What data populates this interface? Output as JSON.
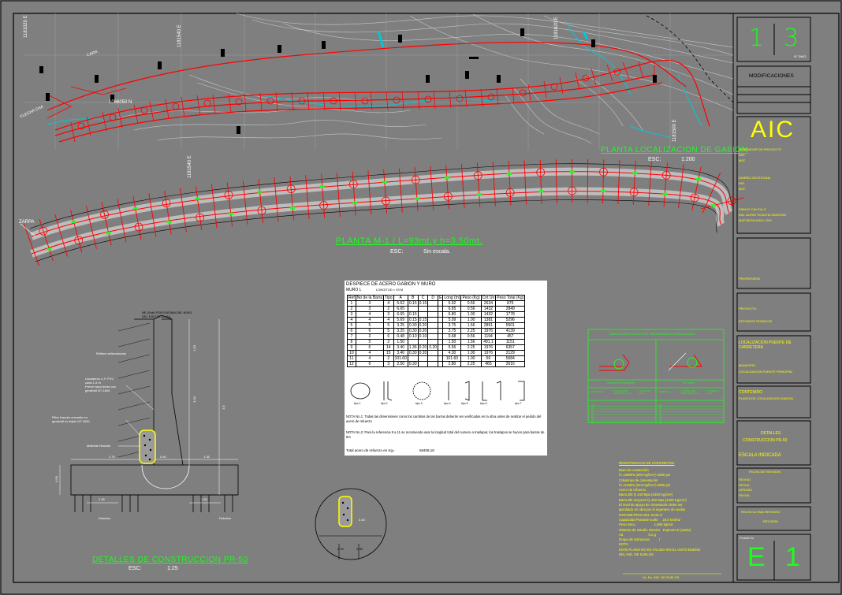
{
  "colors": {
    "background": "#7f7f7f",
    "road": "#ff0000",
    "water": "#00c8d8",
    "contour": "#c8c8c8",
    "label_green": "#19ff19",
    "label_yellow": "#ffff00",
    "frame": "#000000"
  },
  "map": {
    "coords": [
      "1181020 E",
      "1181540 E",
      "1181620 E",
      "1181500 E",
      "1066050 N"
    ],
    "arrow_label": "FLECHA CHA",
    "road_label": "CARR.",
    "title": "PLANTA LOCALIZACION DE GABION",
    "scale_prefix": "ESC:",
    "scale": "1:200"
  },
  "plan": {
    "zarpa": "ZARPA",
    "title": "PLANTA  M-1 /  L=93mt.y  h=3.50mt.",
    "scale_prefix": "ESC:",
    "scale": "Sin escala."
  },
  "section": {
    "top_note": [
      "NE (Sub) POR ENCIMA DEL NIVEL",
      "DEL EJE DE LA VIA"
    ],
    "relleno": "Relleno seleccionado",
    "lloradero": [
      "Lloraderos o 3\" PVC",
      "cada 1.5 m",
      "Prever tapa tecas con",
      "geotextil  NT-1600"
    ],
    "filtro": [
      "Filtro francés envuelto en",
      "geotextil no tejido  NT-1600"
    ],
    "material": "Material triturado",
    "dims": [
      "1.00",
      "4.00",
      "3.5",
      "1.70",
      "0.40",
      "1.35",
      "0.50",
      "1.25",
      "1.50"
    ],
    "dowel_left": "Dobelon",
    "dowel_right": "Dobelon",
    "detail_dims": [
      "0.40",
      "0.30",
      "0.35"
    ],
    "title": "DETALLES  DE  CONSTRUCCION  PR-50",
    "scale_prefix": "ESC:",
    "scale": "1:25"
  },
  "rebar": {
    "title": "DESPIECE DE ACERO GABION Y MURO",
    "subtitle_a": "MURO  L",
    "subtitle_b": "LONGITUD = 93 M",
    "headers": [
      "Ref",
      "No de la Barra",
      "Tipo",
      "A",
      "B",
      "C",
      "D",
      "E",
      "Long (m)",
      "Peso (Kg)",
      "Cnt Un",
      "Peso Total (Kg)"
    ],
    "rows": [
      [
        "1",
        "3",
        "4",
        "5.62",
        "0.15",
        "0.15",
        "",
        "",
        "5.92",
        "0.56",
        "2634",
        "875"
      ],
      [
        "2",
        "3",
        "2",
        "6.65",
        "",
        "",
        "",
        "",
        "6.65",
        "0.56",
        "1432",
        "2849"
      ],
      [
        "3",
        "4",
        "3",
        "6.65",
        "0.15",
        "",
        "",
        "",
        "6.80",
        "1.00",
        "1432",
        "1778"
      ],
      [
        "4",
        "4",
        "4",
        "5.69",
        "0.15",
        "0.15",
        "",
        "",
        "5.99",
        "1.00",
        "1381",
        "5296"
      ],
      [
        "5",
        "5",
        "5",
        "3.25",
        "0.30",
        "0.20",
        "",
        "",
        "3.75",
        "1.56",
        "2851",
        "5501"
      ],
      [
        "6",
        "6",
        "5",
        "3.25",
        "0.30",
        "0.20",
        "",
        "",
        "3.75",
        "2.25",
        "1976",
        "4139"
      ],
      [
        "7",
        "3",
        "6",
        "0.48",
        "0.10",
        "0.10",
        "",
        "",
        "0.68",
        "0.56",
        "1194",
        "457"
      ],
      [
        "8",
        "5",
        "2",
        "1.50",
        "",
        "",
        "",
        "",
        "1.50",
        "1.56",
        "491.1",
        "1151"
      ],
      [
        "9",
        "6",
        "14",
        "3.40",
        "1.36",
        "0.20",
        "0.20",
        "",
        "5.56",
        "2.25",
        "1976",
        "6357"
      ],
      [
        "10",
        "4",
        "15",
        "3.40",
        "0.30",
        "0.20",
        "",
        "",
        "4.30",
        "1.00",
        "1976",
        "2129"
      ],
      [
        "11",
        "4",
        "2",
        "101.60",
        "",
        "",
        "",
        "",
        "101.60",
        "1.00",
        "56",
        "5684"
      ],
      [
        "12",
        "6",
        "3",
        "2.50",
        "0.30",
        "",
        "",
        "",
        "2.80",
        "2.25",
        "465",
        "2616"
      ]
    ],
    "shape_labels": [
      "tipo 1",
      "tipo 2",
      "tipo 3",
      "tipo 4",
      "tipo 5",
      "tipo 6",
      "tipo 7"
    ],
    "note1": "NOTA No.1: Todas las dimensiones como los cambios de las barras deberán ser verificadas en la obra antes de realizar el pedido del acero de refuerzo",
    "note2": "NOTA No.2: Para la referencia 9 a 11 se recomienda usar la longitud total del numero a traslapar, los traslapos se hacen para barras de 6m",
    "total": "Total acero de refuerzo en Kg=",
    "total_value": "58408,18"
  },
  "hooks": {
    "title": "DIMENSIONES GANCHOS PARA BARRAS CORRUGADAS",
    "sub_left": "GANCHO ESTANDAR",
    "sub_right": "ESTRIBO",
    "head": [
      "BARRA No.",
      "D CUPLA DE DOBLADO (mm)",
      "L GANCHO (mm)"
    ],
    "rows": [
      "#3",
      "#4",
      "#5",
      "#6",
      "#7",
      "#8",
      "#9"
    ]
  },
  "specs": {
    "title": "RESISTENCIAS DE CONCRETOS",
    "lines": [
      "Muro de contención",
      "f'c=28MPa (280 Kgf/cm²) 4000 psi",
      "Columnas de cimentación",
      "f'c=21MPa (210 Kgf/cm²) 3000 psi",
      "Acero de refuerzo",
      "Barra Ø3 fy 240 Mpa (2400 Kg/cm²)",
      "Barra Ø4 mayores fy 420 Mpa (4200 Kg/cm²)",
      "El nivel de apoyo de cimentación debe ser",
      "aprobado en obra por el ingeniero de suelos",
      "PARAMETROS DEL SUELO",
      "Capacidad Portante suelo     20,0 ton/m2",
      "Peso Seco                    1,800 kg/m3",
      "Sistema de estudio sísmico   Espectro E (suelo)",
      "Aa                           0,2 g",
      "Grupo de Estructura          I",
      "NOTA:",
      "ESTE PLANO NO ES VALIDO SIN EL VISTO BUENO",
      "DEL ING. DE SUELOS"
    ],
    "signature": "Vo. Bo. ING. DE SUELOS"
  },
  "titleblock": {
    "top_symbol_a": "1",
    "top_symbol_b": "3",
    "top_small": "N° DWG",
    "modificaciones": "MODIFICACIONES",
    "logo": "AIC",
    "lines_a": [
      "DISEÑADOR DE PROYECTO",
      "ING.",
      "MAT."
    ],
    "lines_b": [
      "DISEÑO-GEOTECNIA",
      "ING.",
      "MAT."
    ],
    "lines_c": [
      "DIBUJO CALCULO",
      "ING. ALIRIO ROACHA SANCHEZ",
      "MAT:25202-54511 CND"
    ],
    "box_1": "PROPIETARIO",
    "box_2a": "PROYECTO",
    "box_2b": "ESTUDIOS TECNICOS",
    "box_3a": "LOCALIZACION PUENTE DE CARRETERA",
    "box_3b": "MUNICIPIO",
    "box_3c": "LOCALIZACION PUENTE PRINCIPAL",
    "box_4a": "CONTENIDO",
    "box_4b": "PLANTA DE LOCALIZACION GABION",
    "box_5a": "DETALLES",
    "box_5b": "CONSTRUCCION PR-50",
    "box_5c": "ESCALA  INDICADA",
    "box_6a": "FECHA DE REVISION",
    "box_6b": [
      "REVISO",
      "FECHA",
      "APROBO",
      "FECHA"
    ],
    "box_7a": "FECHA ULTIMA REVISION",
    "box_7b": "REVISION",
    "box_8a": "PLANO N.",
    "bottom_symbol_a": "E",
    "bottom_symbol_b": "1"
  }
}
